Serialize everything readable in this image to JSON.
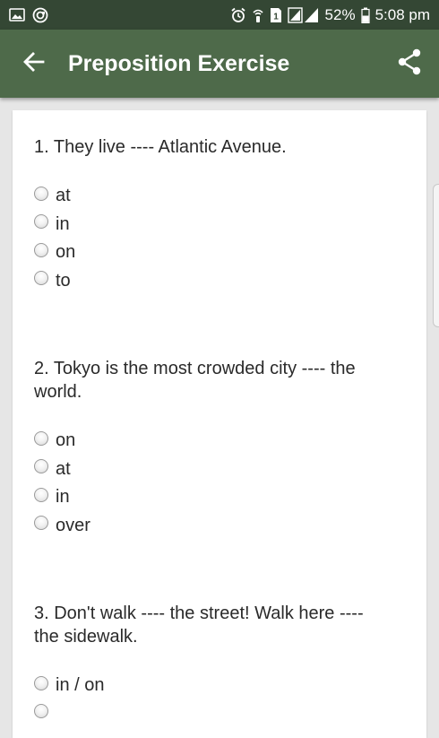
{
  "status_bar": {
    "battery": "52%",
    "time": "5:08 pm",
    "sim_label": "1",
    "icons": [
      "gallery-icon",
      "sync-icon",
      "alarm-icon",
      "wifi-calling-icon",
      "sim-icon",
      "signal-icon",
      "battery-icon"
    ]
  },
  "app_bar": {
    "title": "Preposition Exercise",
    "back_icon": "arrow-back-icon",
    "share_icon": "share-icon",
    "color": "#4e6a4a"
  },
  "questions": [
    {
      "text": "1. They live ---- Atlantic Avenue.",
      "options": [
        "at",
        "in",
        "on",
        "to"
      ]
    },
    {
      "text": "2. Tokyo is the most crowded city ---- the world.",
      "options": [
        "on",
        "at",
        "in",
        "over"
      ]
    },
    {
      "text": "3. Don't walk ---- the street! Walk here ---- the sidewalk.",
      "options": [
        "in / on"
      ]
    }
  ]
}
